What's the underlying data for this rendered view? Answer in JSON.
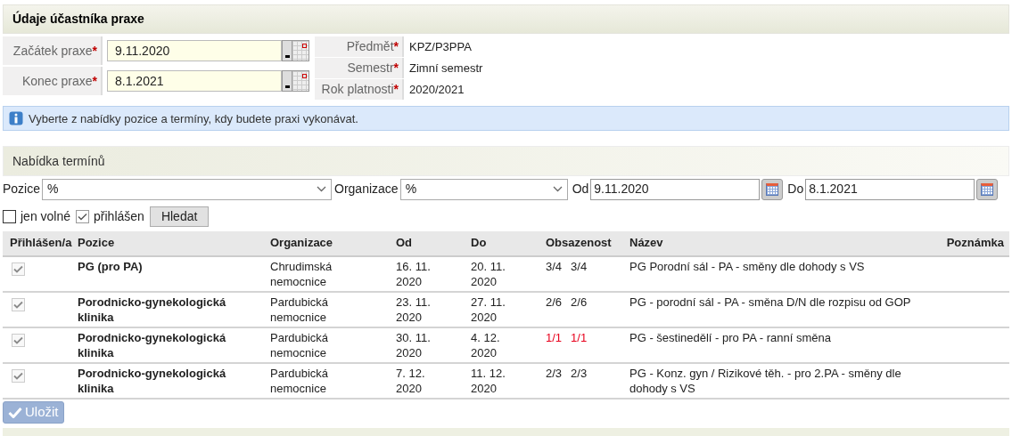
{
  "participant_section": {
    "title": "Údaje účastníka praxe"
  },
  "date_fields": [
    {
      "label": "Začátek praxe",
      "required_mark": "*",
      "value": "9.11.2020"
    },
    {
      "label": "Konec praxe",
      "required_mark": "*",
      "value": "8.1.2021"
    }
  ],
  "info_fields": [
    {
      "label": "Předmět",
      "required_mark": "*",
      "value": "KPZ/P3PPA"
    },
    {
      "label": "Semestr",
      "required_mark": "*",
      "value": "Zimní semestr"
    },
    {
      "label": "Rok platnosti",
      "required_mark": "*",
      "value": "2020/2021"
    }
  ],
  "info_message": "Vyberte z nabídky pozice a termíny, kdy budete praxi vykonávat.",
  "offer_section": {
    "title": "Nabídka termínů"
  },
  "filters": {
    "position": {
      "label": "Pozice",
      "value": "%"
    },
    "organization": {
      "label": "Organizace",
      "value": "%"
    },
    "from": {
      "label": "Od",
      "value": "9.11.2020"
    },
    "to": {
      "label": "Do",
      "value": "8.1.2021"
    }
  },
  "options": [
    {
      "label": "jen volné",
      "checked": false
    },
    {
      "label": "přihlášen",
      "checked": true
    }
  ],
  "search_button": "Hledat",
  "table": {
    "columns": [
      "Přihlášen/a",
      "Pozice",
      "Organizace",
      "Od",
      "Do",
      "Obsazenost",
      "Název",
      "Poznámka"
    ],
    "rows": [
      {
        "checked": true,
        "disabled": true,
        "position": "PG (pro PA)",
        "organization": "Chrudimská nemocnice",
        "from": "16. 11. 2020",
        "to": "20. 11. 2020",
        "occupancy_1": "3/4",
        "occupancy_2": "3/4",
        "full": false,
        "name": "PG Porodní sál - PA - směny dle dohody s VS"
      },
      {
        "checked": true,
        "disabled": true,
        "position": "Porodnicko-gynekologická klinika",
        "organization": "Pardubická nemocnice",
        "from": "23. 11. 2020",
        "to": "27. 11. 2020",
        "occupancy_1": "2/6",
        "occupancy_2": "2/6",
        "full": false,
        "name": "PG - porodní sál - PA - směna D/N dle rozpisu od GOP"
      },
      {
        "checked": true,
        "disabled": true,
        "position": "Porodnicko-gynekologická klinika",
        "organization": "Pardubická nemocnice",
        "from": "30. 11. 2020",
        "to": "4. 12. 2020",
        "occupancy_1": "1/1",
        "occupancy_2": "1/1",
        "full": true,
        "name": "PG - šestinedělí - pro PA - ranní směna"
      },
      {
        "checked": true,
        "disabled": true,
        "position": "Porodnicko-gynekologická klinika",
        "organization": "Pardubická nemocnice",
        "from": "7. 12. 2020",
        "to": "11. 12. 2020",
        "occupancy_1": "2/3",
        "occupancy_2": "2/3",
        "full": false,
        "name": "PG - Konz. gyn / Rizikové těh. - pro 2.PA - směny dle dohody s VS"
      }
    ]
  },
  "save_button": {
    "label": "Uložit",
    "disabled": true
  }
}
